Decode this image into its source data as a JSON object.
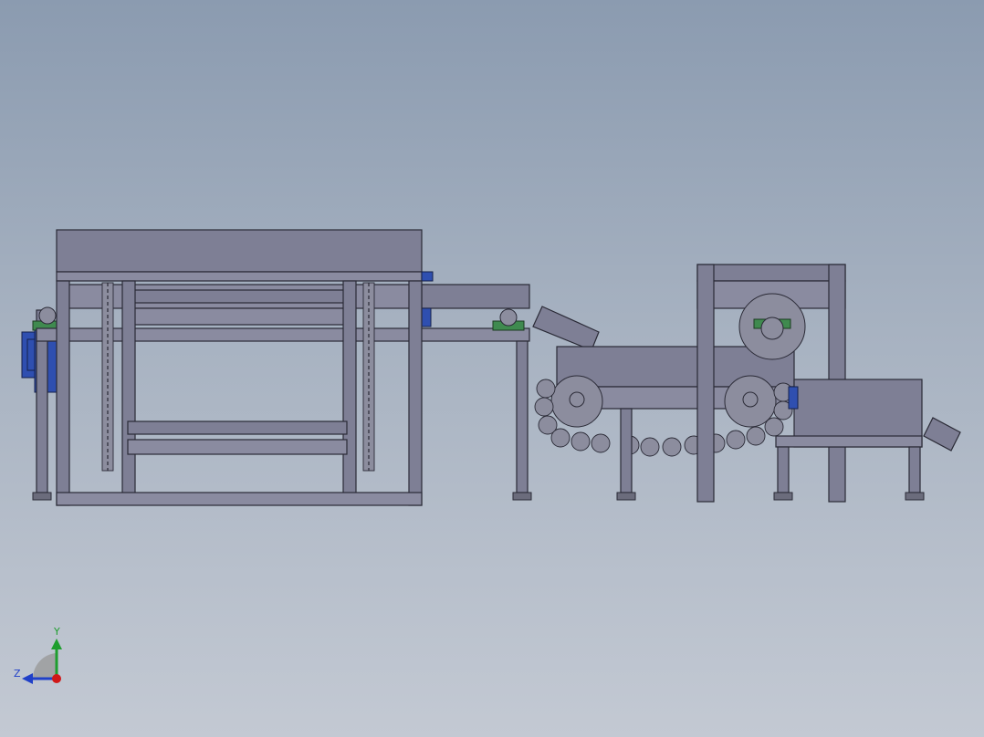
{
  "viewport": {
    "background_top": "#8b9bb0",
    "background_bottom": "#c3c9d3"
  },
  "model": {
    "frame_color": "#7e7f95",
    "frame_stroke": "#2a2a36",
    "motor_color": "#2f4fb0",
    "bearing_color": "#3f8a4f",
    "chain_color": "#6f7080"
  },
  "triad": {
    "y_label": "Y",
    "z_label": "Z",
    "y_color": "#1e9e2e",
    "z_color": "#2040c8",
    "x_color": "#d01818",
    "icon": "coordinate-triad-icon"
  }
}
